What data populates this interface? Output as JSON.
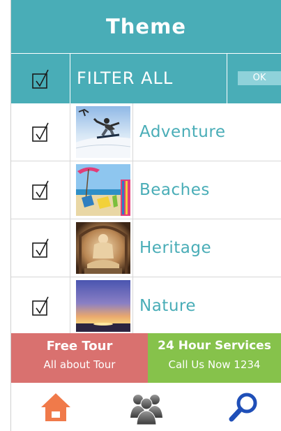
{
  "header": {
    "title": "Theme"
  },
  "filter": {
    "label": "FILTER ALL",
    "ok_label": "OK"
  },
  "themes": [
    {
      "label": "Adventure",
      "image": "snowboard-photo"
    },
    {
      "label": "Beaches",
      "image": "beach-chairs-photo"
    },
    {
      "label": "Heritage",
      "image": "buddha-statue-photo"
    },
    {
      "label": "Nature",
      "image": "sunset-photo"
    }
  ],
  "promo": {
    "left": {
      "title": "Free Tour",
      "subtitle": "All about Tour"
    },
    "right": {
      "title": "24 Hour Services",
      "subtitle": "Call Us Now 1234"
    }
  },
  "nav": {
    "icons": [
      "home-icon",
      "people-icon",
      "search-icon"
    ]
  },
  "colors": {
    "accent": "#49adb7",
    "promo_left": "#d9716f",
    "promo_right": "#86c24b",
    "home_icon": "#f07a4a",
    "search_icon": "#1f4fb8"
  }
}
